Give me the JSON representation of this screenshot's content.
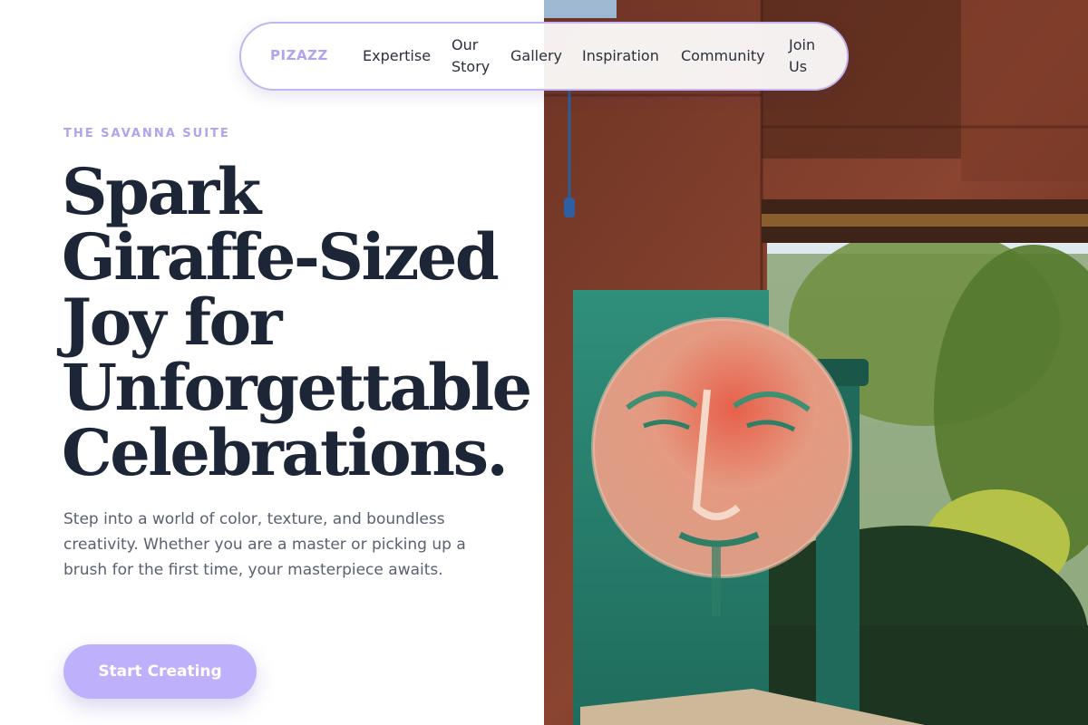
{
  "nav": {
    "brand": "PIZAZZ",
    "links": [
      {
        "label": "Expertise"
      },
      {
        "label": "Our Story"
      },
      {
        "label": "Gallery"
      },
      {
        "label": "Inspiration"
      },
      {
        "label": "Community"
      },
      {
        "label": "Join Us"
      }
    ]
  },
  "hero": {
    "eyebrow": "THE SAVANNA SUITE",
    "headline_lines": [
      "Spark",
      "Giraffe-Sized",
      "Joy for",
      "Unforgettable",
      "Celebrations."
    ],
    "lede": "Step into a world of color, texture, and boundless creativity. Whether you are a master or picking up a brush for the first time, your masterpiece awaits.",
    "cta_label": "Start Creating"
  },
  "colors": {
    "accent": "#bfb0fb",
    "brand": "#b3a2ee",
    "headline": "#1c2636",
    "body": "#5a6070"
  }
}
